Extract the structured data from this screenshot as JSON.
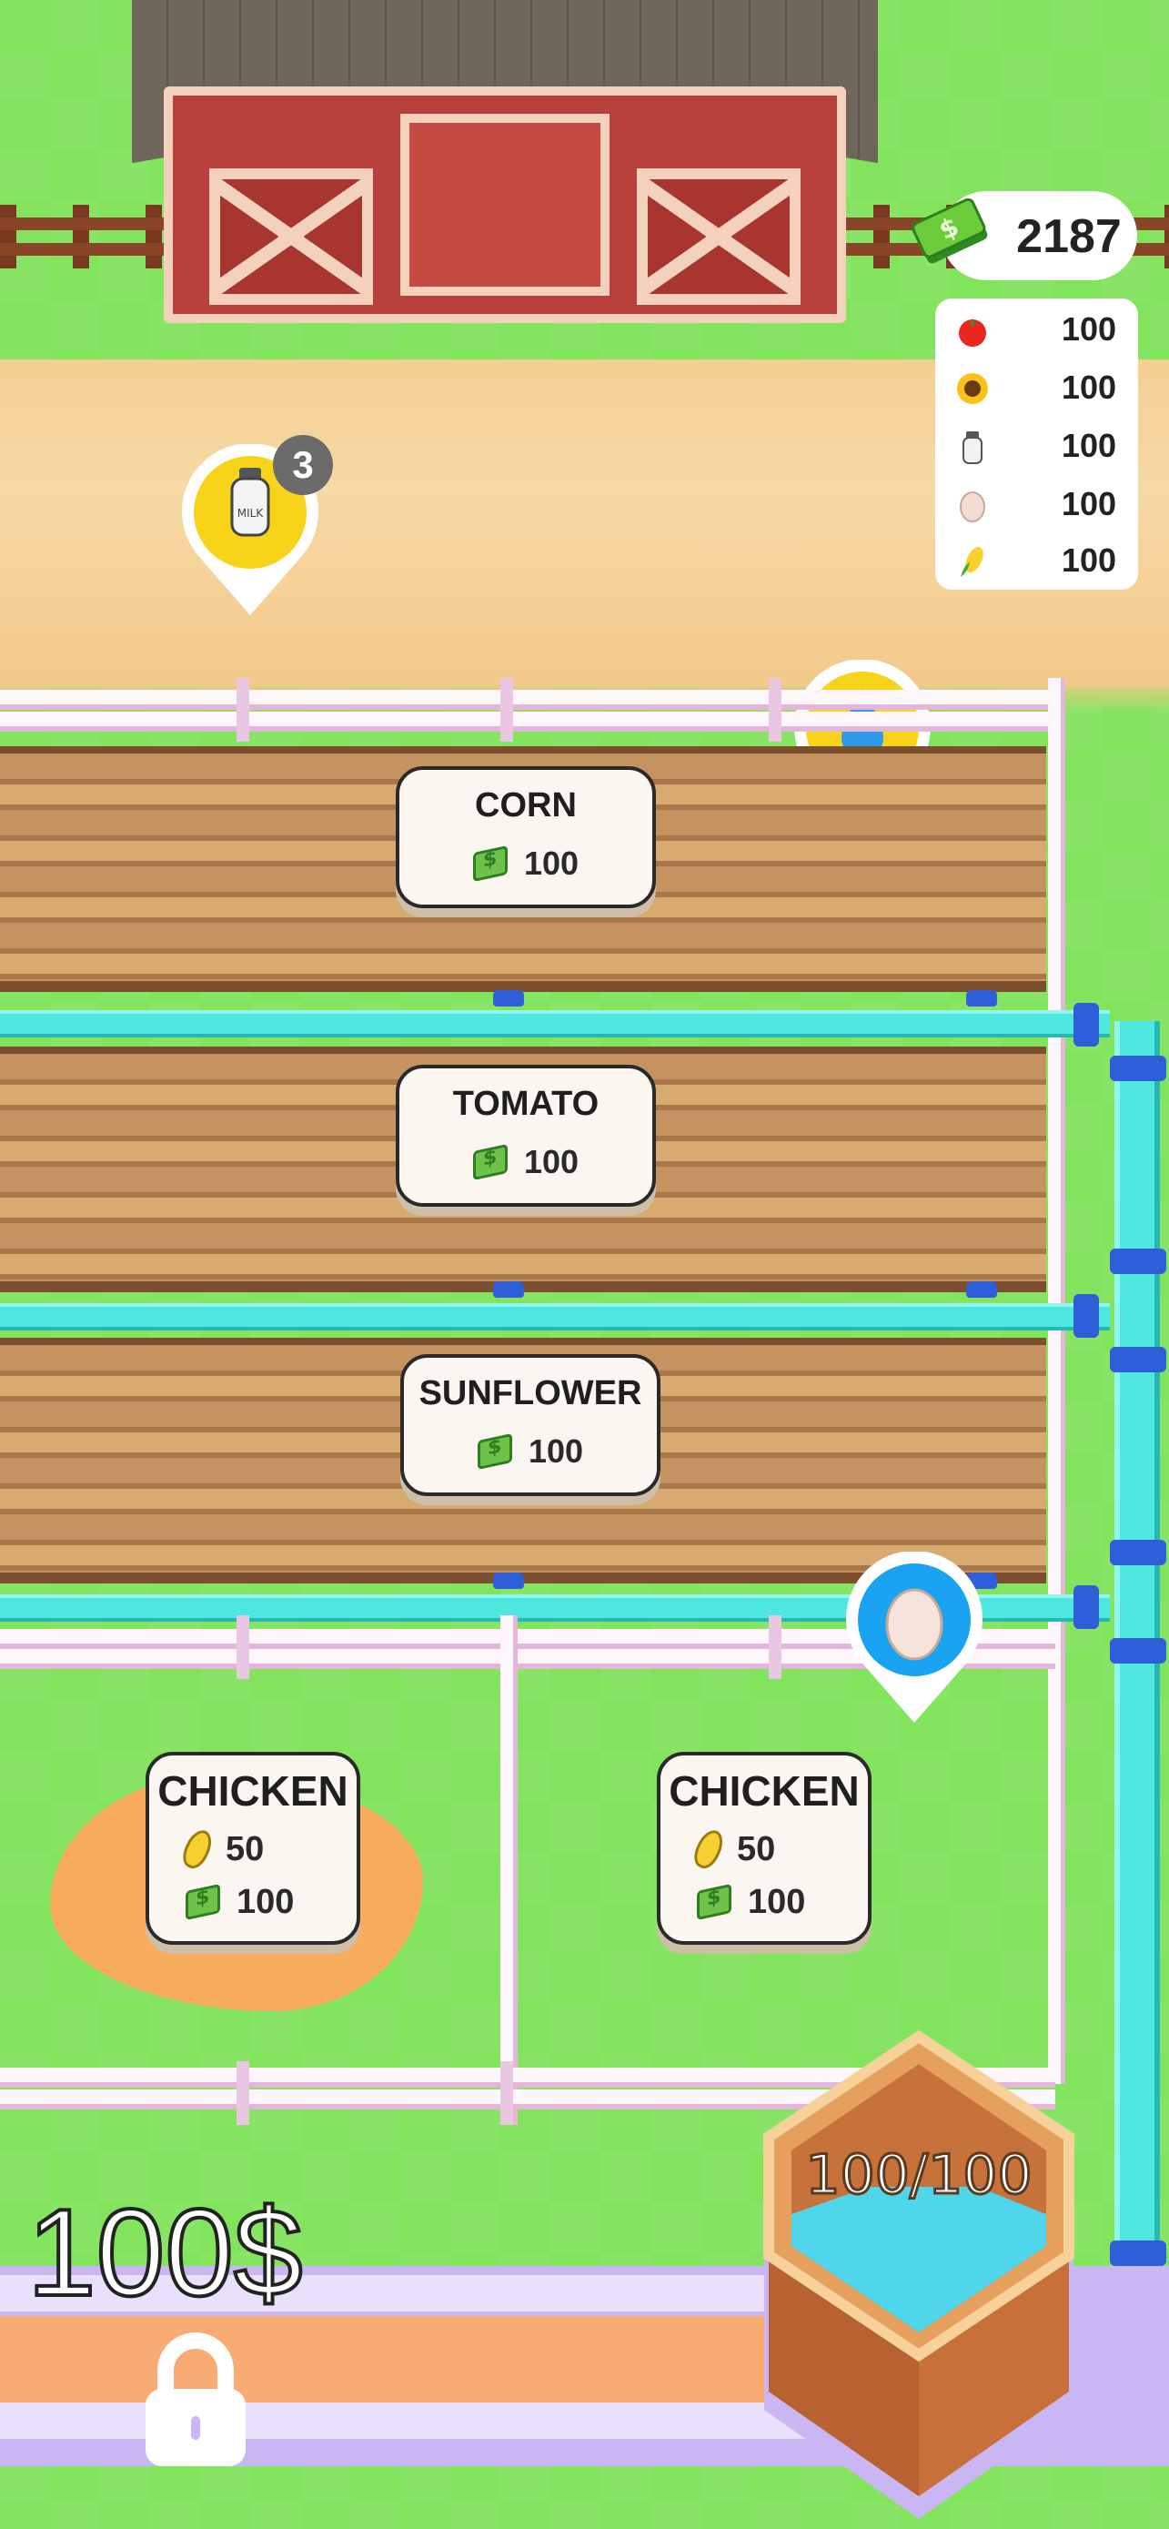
{
  "wallet": {
    "cash": "2187"
  },
  "inventory": [
    {
      "icon": "tomato-icon",
      "value": "100"
    },
    {
      "icon": "sunflower-icon",
      "value": "100"
    },
    {
      "icon": "milk-bottle-icon",
      "value": "100"
    },
    {
      "icon": "egg-icon",
      "value": "100"
    },
    {
      "icon": "corn-icon",
      "value": "100"
    }
  ],
  "milk_pickup": {
    "icon": "milk-bottle-icon",
    "label": "MILK",
    "count": "3"
  },
  "fields": [
    {
      "name": "CORN",
      "price": "100"
    },
    {
      "name": "TOMATO",
      "price": "100"
    },
    {
      "name": "SUNFLOWER",
      "price": "100"
    }
  ],
  "pens": [
    {
      "name": "CHICKEN",
      "corn_cost": "50",
      "cash_cost": "100"
    },
    {
      "name": "CHICKEN",
      "corn_cost": "50",
      "cash_cost": "100"
    }
  ],
  "locked_plot": {
    "price": "100$"
  },
  "water_tank": {
    "level": "100/100"
  },
  "colors": {
    "pin_yellow": "#f7d31a",
    "pin_blue": "#1aa3f0",
    "pipe": "#4fe8e0",
    "joint": "#2f5fd8"
  }
}
